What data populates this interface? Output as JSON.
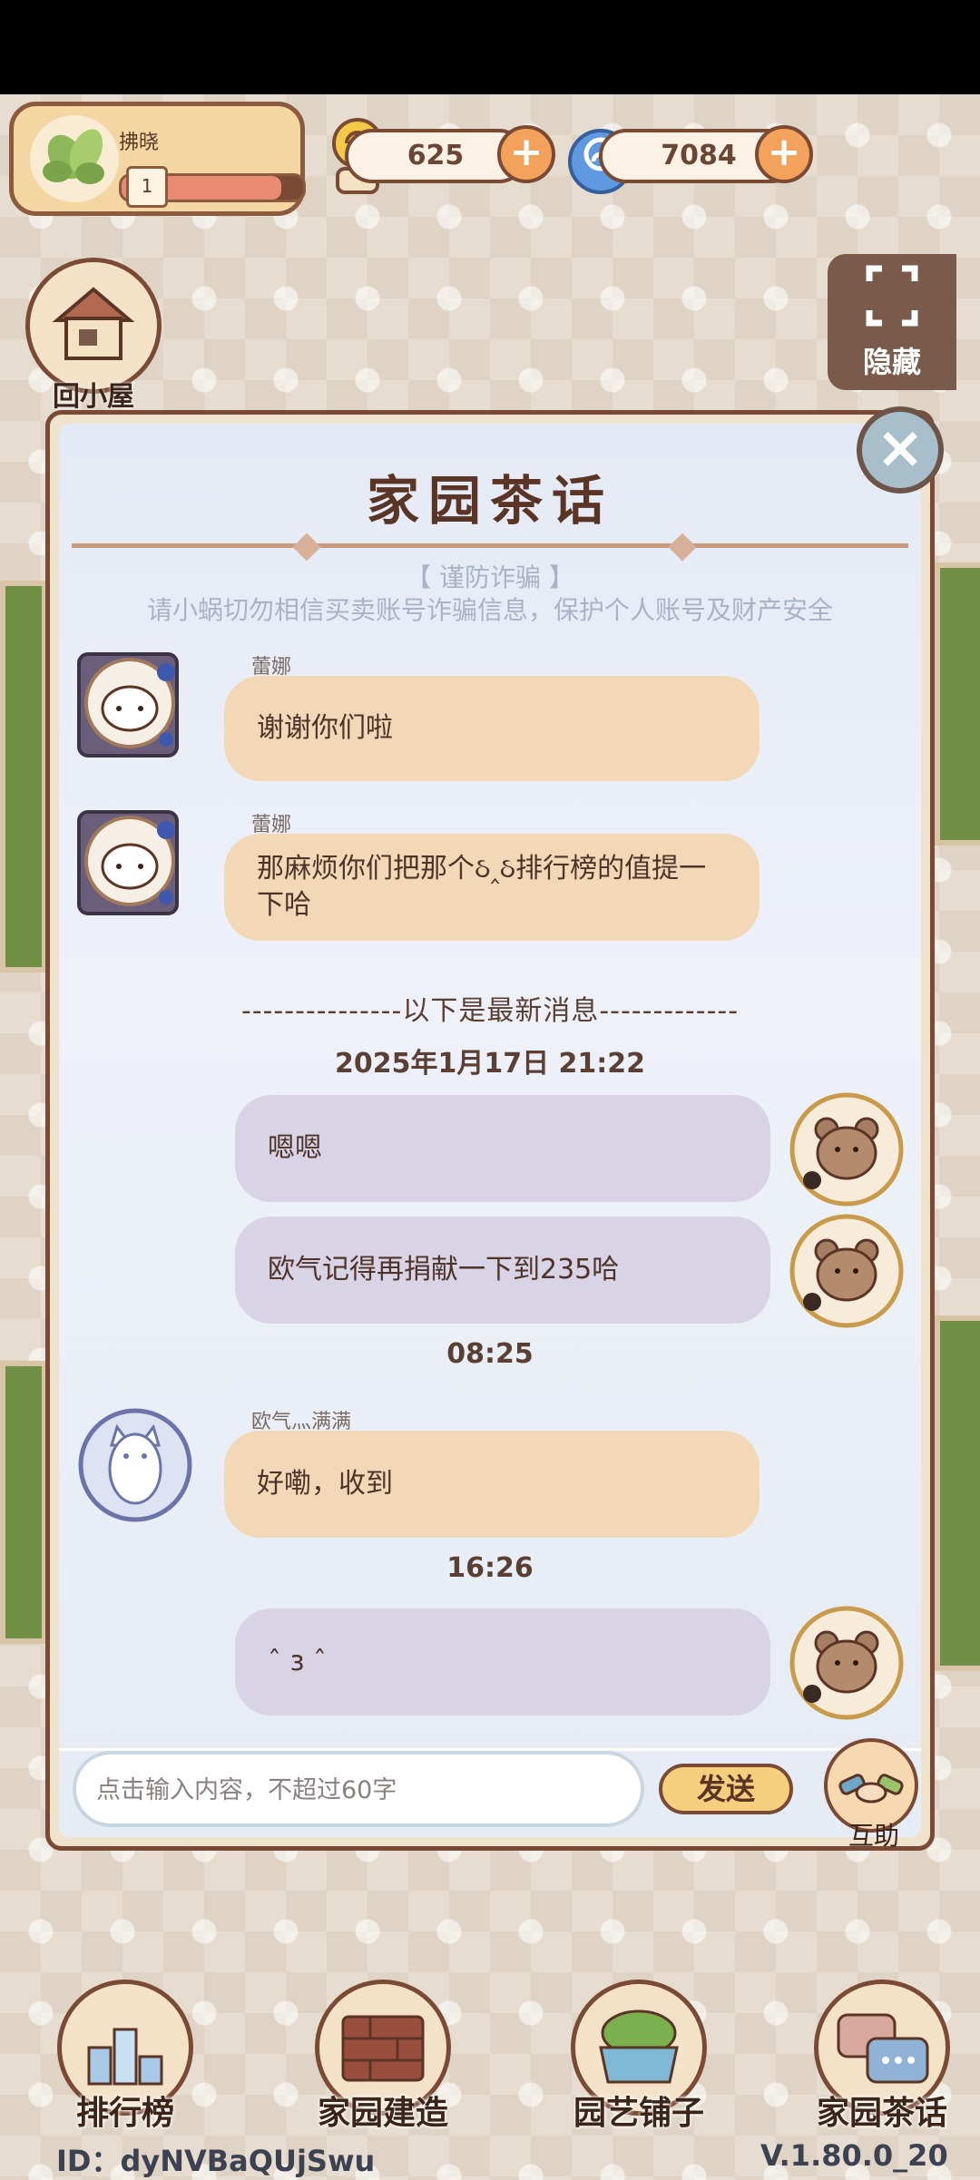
{
  "profile": {
    "name": "拂晓",
    "level": "1",
    "exp_fraction": 0.88
  },
  "currency": {
    "snail": "625",
    "swirl": "7084"
  },
  "side": {
    "home_label": "回小屋",
    "hide_label": "隐藏"
  },
  "dialog": {
    "title": "家园茶话",
    "notice_title": "【 谨防诈骗 】",
    "notice_text": "请小蜗切勿相信买卖账号诈骗信息，保护个人账号及财产安全",
    "messages_old": [
      {
        "sender": "蕾娜",
        "text": "谢谢你们啦"
      },
      {
        "sender": "蕾娜",
        "text": "那麻烦你们把那个ઠ‸ઠ排行榜的值提一下哈"
      }
    ],
    "divider": "---------------以下是最新消息-------------",
    "timestamp1": "2025年1月17日 21:22",
    "out1": "嗯嗯",
    "out2": "欧气记得再捐献一下到235哈",
    "timestamp2": "08:25",
    "in3_sender": "欧气灬满满",
    "in3_text": "好嘞，收到",
    "timestamp3": "16:26",
    "out3": "ˆ з ˆ",
    "input_placeholder": "点击输入内容，不超过60字",
    "send_label": "发送",
    "help_label": "互助"
  },
  "nav": {
    "ranking": "排行榜",
    "build": "家园建造",
    "shop": "园艺铺子",
    "chat": "家园茶话"
  },
  "footer": {
    "id": "ID：dyNVBaQUjSwu",
    "version": "V.1.80.0_20"
  },
  "colors": {
    "brown": "#7a4a35",
    "bubble_in": "#f2d8b6",
    "bubble_out": "#d9d3e6"
  }
}
